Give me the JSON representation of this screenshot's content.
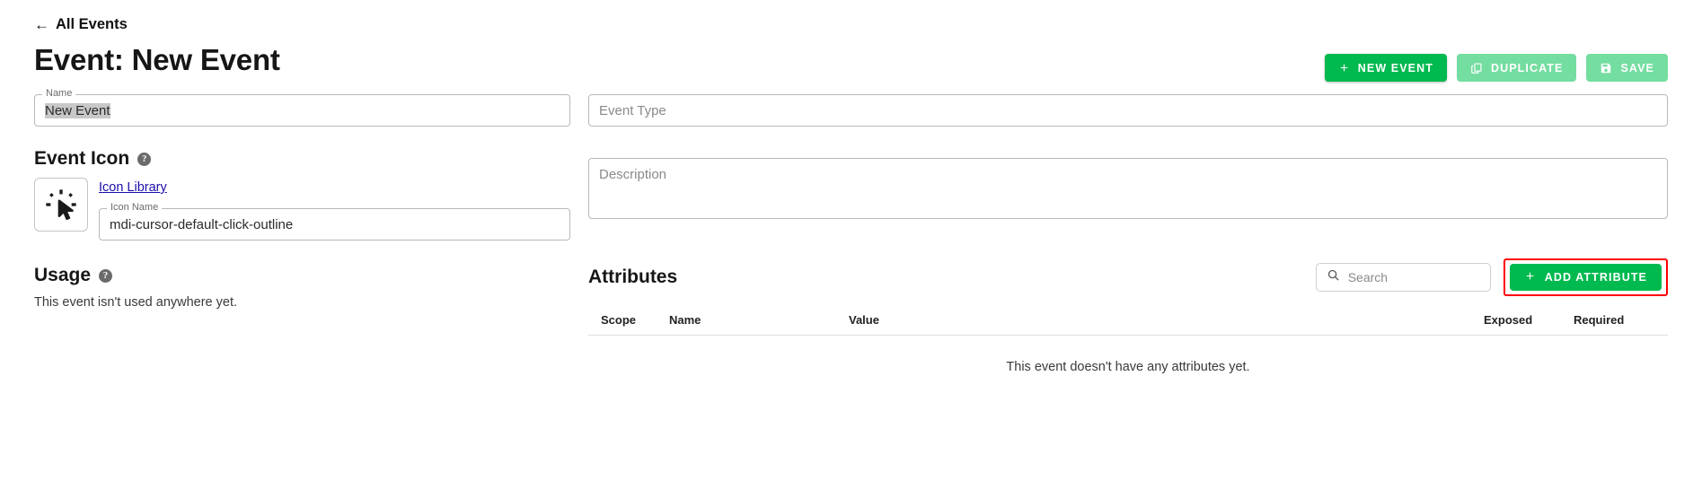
{
  "breadcrumb": {
    "back_label": "All Events",
    "back_arrow": "←"
  },
  "header": {
    "title": "Event: New Event",
    "buttons": [
      {
        "label": "NEW EVENT",
        "icon": "plus-icon",
        "style": "primary"
      },
      {
        "label": "DUPLICATE",
        "icon": "copy-icon",
        "style": "muted"
      },
      {
        "label": "SAVE",
        "icon": "save-icon",
        "style": "muted"
      }
    ]
  },
  "form": {
    "name": {
      "label": "Name",
      "value": "New Event",
      "selected": true
    },
    "event_type": {
      "placeholder": "Event Type",
      "value": ""
    },
    "description": {
      "placeholder": "Description",
      "value": ""
    }
  },
  "event_icon": {
    "heading": "Event Icon",
    "help": "?",
    "library_link": "Icon Library",
    "preview_icon": "mdi-cursor-default-click-outline",
    "icon_name": {
      "label": "Icon Name",
      "value": "mdi-cursor-default-click-outline"
    }
  },
  "usage": {
    "heading": "Usage",
    "help": "?",
    "text": "This event isn't used anywhere yet."
  },
  "attributes": {
    "title": "Attributes",
    "search": {
      "placeholder": "Search",
      "value": "",
      "icon": "search-icon"
    },
    "add_button": {
      "label": "ADD ATTRIBUTE",
      "icon": "plus-icon",
      "highlighted": true
    },
    "columns": [
      "Scope",
      "Name",
      "Value",
      "Exposed",
      "Required"
    ],
    "rows": [],
    "empty_message": "This event doesn't have any attributes yet."
  },
  "colors": {
    "accent_green": "#00b94f",
    "muted_green": "#74dda0",
    "link_blue": "#1a0dab",
    "highlight_red": "#ff0000",
    "selection_gray": "#c8c8c8"
  }
}
